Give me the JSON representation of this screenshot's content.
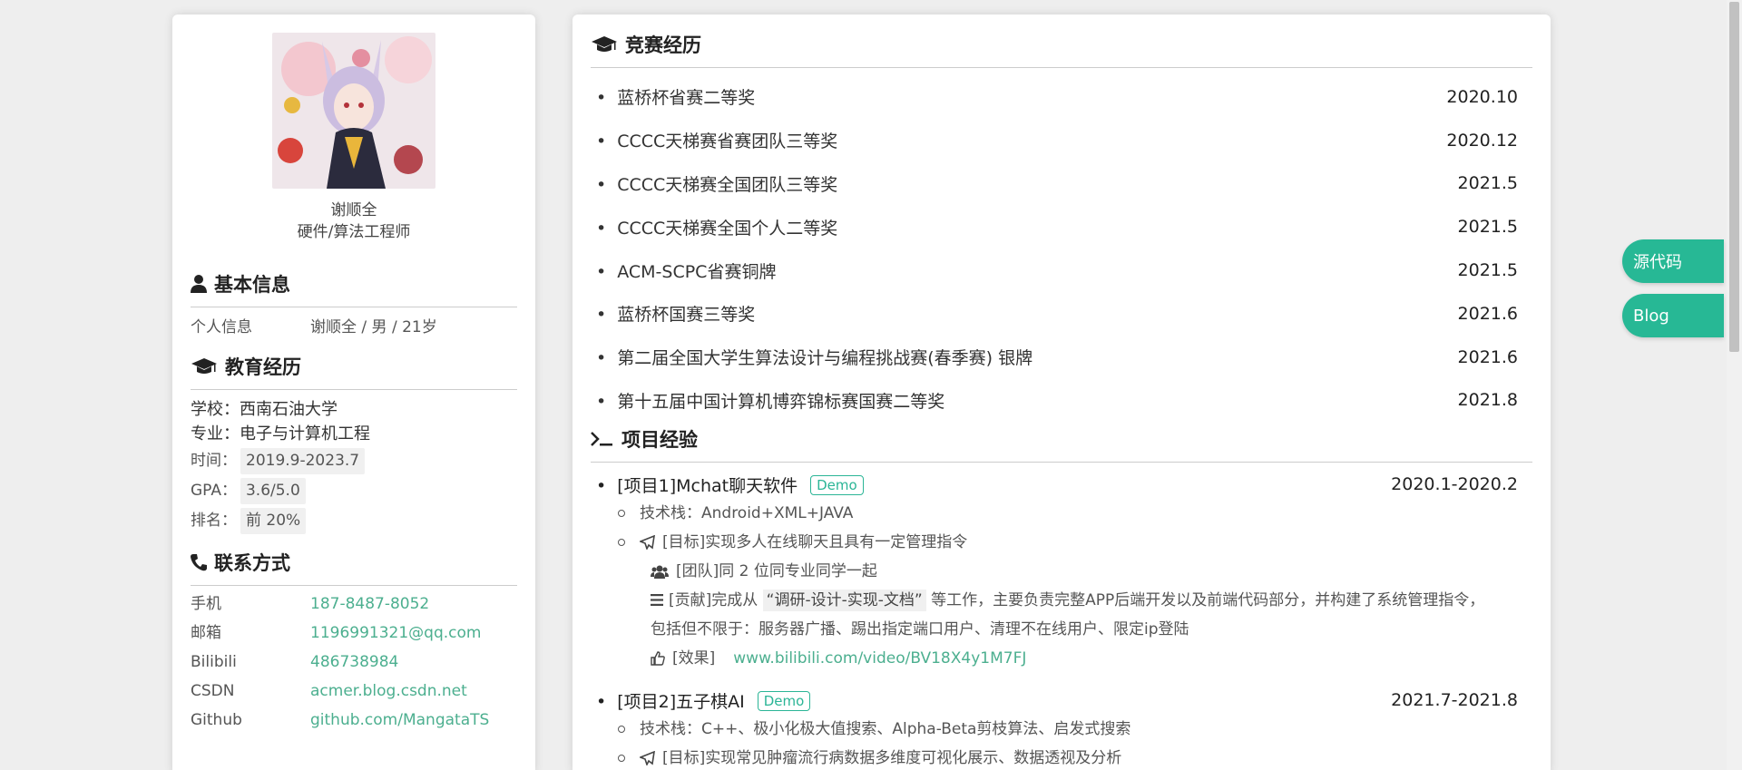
{
  "profile": {
    "name": "谢顺全",
    "role": "硬件/算法工程师"
  },
  "basic": {
    "title": "基本信息",
    "label": "个人信息",
    "value": "谢顺全 / 男 / 21岁"
  },
  "education": {
    "title": "教育经历",
    "school_label": "学校：",
    "school": "西南石油大学",
    "major_label": "专业：",
    "major": "电子与计算机工程",
    "time_label": "时间：",
    "time": "2019.9-2023.7",
    "gpa_label": "GPA：",
    "gpa": "3.6/5.0",
    "rank_label": "排名：",
    "rank": "前 20%"
  },
  "contact": {
    "title": "联系方式",
    "items": [
      {
        "label": "手机",
        "value": "187-8487-8052"
      },
      {
        "label": "邮箱",
        "value": "1196991321@qq.com"
      },
      {
        "label": "Bilibili",
        "value": "486738984"
      },
      {
        "label": "CSDN",
        "value": "acmer.blog.csdn.net"
      },
      {
        "label": "Github",
        "value": "github.com/MangataTS"
      }
    ]
  },
  "awards": {
    "title": "竞赛经历",
    "items": [
      {
        "name": "蓝桥杯省赛二等奖",
        "date": "2020.10"
      },
      {
        "name": "CCCC天梯赛省赛团队三等奖",
        "date": "2020.12"
      },
      {
        "name": "CCCC天梯赛全国团队三等奖",
        "date": "2021.5"
      },
      {
        "name": "CCCC天梯赛全国个人二等奖",
        "date": "2021.5"
      },
      {
        "name": "ACM-SCPC省赛铜牌",
        "date": "2021.5"
      },
      {
        "name": "蓝桥杯国赛三等奖",
        "date": "2021.6"
      },
      {
        "name": "第二届全国大学生算法设计与编程挑战赛(春季赛) 银牌",
        "date": "2021.6"
      },
      {
        "name": "第十五届中国计算机博弈锦标赛国赛二等奖",
        "date": "2021.8"
      }
    ]
  },
  "projects": {
    "title": "项目经验",
    "p1": {
      "name": "[项目1]Mchat聊天软件",
      "badge": "Demo",
      "date": "2020.1-2020.2",
      "stack": "技术栈：Android+XML+JAVA",
      "goal": "[目标]实现多人在线聊天且具有一定管理指令",
      "team": "[团队]同 2 位同专业同学一起",
      "contrib_pre": "[贡献]完成从",
      "contrib_hl": "“调研-设计-实现-文档”",
      "contrib_post": "等工作，主要负责完整APP后端开发以及前端代码部分，并构建了系统管理指令， 包括但不限于：服务器广播、踢出指定端口用户、清理不在线用户、限定ip登陆",
      "effect_label": "[效果]",
      "effect_link": "www.bilibili.com/video/BV18X4y1M7FJ"
    },
    "p2": {
      "name": "[项目2]五子棋AI",
      "badge": "Demo",
      "date": "2021.7-2021.8",
      "stack": "技术栈：C++、极小化极大值搜索、Alpha-Beta剪枝算法、启发式搜索",
      "goal": "[目标]实现常见肿瘤流行病数据多维度可视化展示、数据透视及分析"
    }
  },
  "side_buttons": {
    "source": "源代码",
    "blog": "Blog"
  },
  "colors": {
    "accent": "#27b895",
    "link": "#4caf8f",
    "background": "#eeeeee"
  }
}
